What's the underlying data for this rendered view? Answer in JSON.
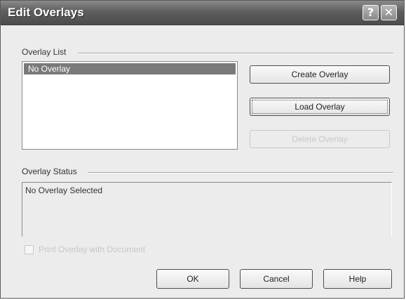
{
  "window": {
    "title": "Edit Overlays"
  },
  "titlebar_buttons": {
    "help_icon": "question-mark",
    "close_icon": "x"
  },
  "overlay_list": {
    "group_label": "Overlay List",
    "items": [
      {
        "label": "No Overlay",
        "selected": true
      }
    ]
  },
  "side_buttons": {
    "create": "Create Overlay",
    "load": "Load Overlay",
    "delete": "Delete Overlay"
  },
  "overlay_status": {
    "group_label": "Overlay Status",
    "text": "No Overlay Selected"
  },
  "checkbox": {
    "label": "Print Overlay with Document",
    "checked": false,
    "enabled": false
  },
  "footer_buttons": {
    "ok": "OK",
    "cancel": "Cancel",
    "help": "Help"
  },
  "colors": {
    "titlebar": "#5e5e5e",
    "selection": "#7a7a7a",
    "dialog_bg": "#ececec"
  }
}
